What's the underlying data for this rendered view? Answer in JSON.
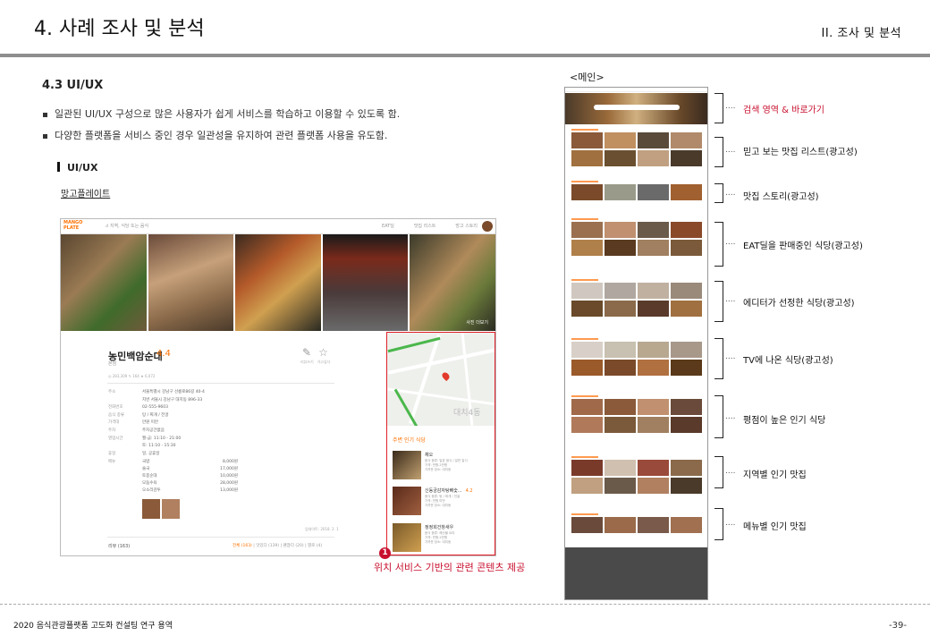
{
  "header": {
    "title": "4. 사례 조사 및 분석",
    "section": "II.   조사 및 분석"
  },
  "subtitle": "4.3 UI/UX",
  "bullets": [
    "일관된 UI/UX 구성으로 많은 사용자가 쉽게 서비스를 학습하고 이용할 수 있도록 함.",
    "다양한 플랫폼을 서비스 중인 경우 일관성을 유지하여 관련 플랫폼 사용을 유도함."
  ],
  "uiux_heading": "UI/UX",
  "mango_label": "망고플레이트",
  "mango": {
    "logo": "MANGO PLATE",
    "search_placeholder": "지역, 식당 또는 음식",
    "nav": [
      "EAT딜",
      "맛집 리스트",
      "망고 스토리"
    ],
    "photo_tag": "사진 더보기",
    "restaurant": {
      "name": "농민백암순대",
      "score": "4.4",
      "area": "본점",
      "stats": "◎ 283,309   ✎ 164   ★ 6,072",
      "want": "리뷰쓰기",
      "fav": "가고싶다"
    },
    "info": [
      {
        "k": "주소",
        "v": "서울특별시 강남구 선릉로86길 40-4"
      },
      {
        "k": "",
        "v": "지번 서울시 강남구 대치동 896-33"
      },
      {
        "k": "전화번호",
        "v": "02-555-9603"
      },
      {
        "k": "음식 종류",
        "v": "탕 / 찌개 / 전골"
      },
      {
        "k": "가격대",
        "v": "만원 미만"
      },
      {
        "k": "주차",
        "v": "주차공간없음"
      },
      {
        "k": "영업시간",
        "v": "월-금: 11:10 - 21:00"
      },
      {
        "k": "",
        "v": "토: 11:10 - 15:30"
      },
      {
        "k": "휴일",
        "v": "일, 공휴일"
      }
    ],
    "menu_label": "메뉴",
    "menu": [
      {
        "n": "국밥",
        "p": "8,000원"
      },
      {
        "n": "술국",
        "p": "17,000원"
      },
      {
        "n": "토종순대",
        "p": "10,000원"
      },
      {
        "n": "모둠수육",
        "p": "28,000원"
      },
      {
        "n": "오소리감투",
        "p": "13,000원"
      }
    ],
    "updated": "업데이트: 2018. 2. 1",
    "reviews": "리뷰 (163)",
    "review_tabs": [
      "전체 (163)",
      "맛있다 (139)",
      "괜찮다 (20)",
      "별로 (4)"
    ],
    "map_text": "대치4동",
    "popular_title": "주변 인기 식당",
    "popular": [
      {
        "name": "채오",
        "score": "",
        "desc": [
          "음식 종류: 일본 음식 / 일반 일식",
          "가격: 만원-2만원",
          "가까운 장소: 대치동"
        ]
      },
      {
        "name": "신동궁감자탕뼈숯...",
        "score": "4.2",
        "desc": [
          "음식 종류: 탕 / 찌개 / 전골",
          "가격: 만원 미만",
          "가까운 장소: 대치동"
        ]
      },
      {
        "name": "정정희건창새우",
        "score": "",
        "desc": [
          "음식 종류: 해산물 요리",
          "가격: 만원-2만원",
          "가까운 장소: 대치동"
        ]
      }
    ]
  },
  "caption": {
    "badge": "1",
    "text": "위치 서비스 기반의 관련 콘텐츠 제공"
  },
  "main_label": "<메인>",
  "sections": [
    "검색 영역 & 바로가기",
    "믿고 보는 맛집 리스트(광고성)",
    "맛집 스토리(광고성)",
    "EAT딜을 판매중인 식당(광고성)",
    "에디터가 선정한 식당(광고성)",
    "TV에 나온 식당(광고성)",
    "평점이 높은 인기 식당",
    "지역별 인기 맛집",
    "메뉴별 인기 맛집"
  ],
  "accent": "#c8102e",
  "brand": "#ff7100",
  "footer": {
    "left": "2020 음식관광플랫폼 고도화 컨설팅 연구 용역",
    "page": "-39-"
  }
}
